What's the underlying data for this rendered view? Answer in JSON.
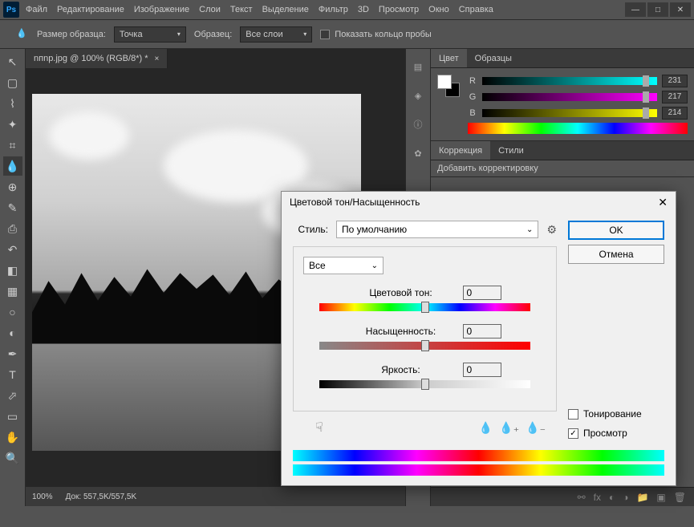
{
  "menus": [
    "Файл",
    "Редактирование",
    "Изображение",
    "Слои",
    "Текст",
    "Выделение",
    "Фильтр",
    "3D",
    "Просмотр",
    "Окно",
    "Справка"
  ],
  "options": {
    "sample_size_label": "Размер образца:",
    "sample_size_value": "Точка",
    "sample_label": "Образец:",
    "sample_value": "Все слои",
    "show_ring_label": "Показать кольцо пробы"
  },
  "doc_tab": "nпnp.jpg @ 100% (RGB/8*) *",
  "status": {
    "zoom": "100%",
    "doc_label": "Док:",
    "doc_value": "557,5K/557,5K"
  },
  "panels": {
    "color_tab": "Цвет",
    "swatches_tab": "Образцы",
    "r": "R",
    "r_val": "231",
    "g": "G",
    "g_val": "217",
    "b": "B",
    "b_val": "214",
    "correction_tab": "Коррекция",
    "styles_tab": "Стили",
    "add_correction": "Добавить корректировку"
  },
  "dialog": {
    "title": "Цветовой тон/Насыщенность",
    "style_label": "Стиль:",
    "style_value": "По умолчанию",
    "channel_value": "Все",
    "hue_label": "Цветовой тон:",
    "hue_val": "0",
    "sat_label": "Насыщенность:",
    "sat_val": "0",
    "light_label": "Яркость:",
    "light_val": "0",
    "ok": "OK",
    "cancel": "Отмена",
    "colorize": "Тонирование",
    "preview": "Просмотр"
  }
}
